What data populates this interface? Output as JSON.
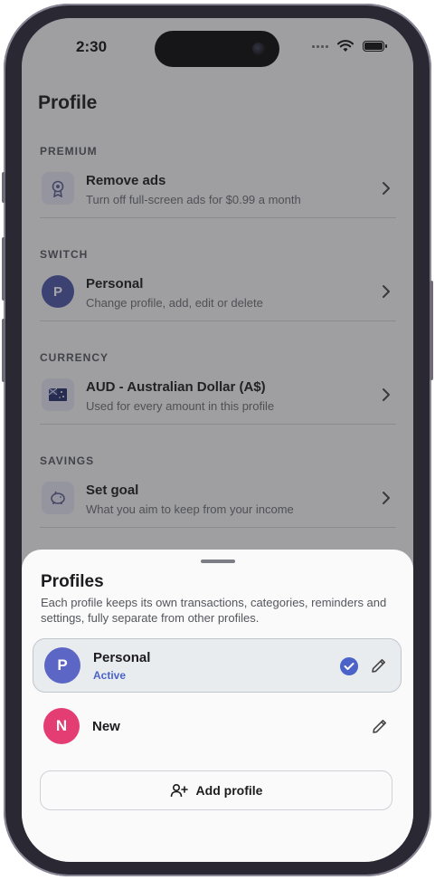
{
  "status_bar": {
    "time": "2:30"
  },
  "page": {
    "title": "Profile"
  },
  "sections": [
    {
      "label": "PREMIUM",
      "title": "Remove ads",
      "subtitle": "Turn off full-screen ads for $0.99 a month",
      "icon": "ribbon-icon"
    },
    {
      "label": "SWITCH",
      "title": "Personal",
      "subtitle": "Change profile, add, edit or delete",
      "avatar_letter": "P",
      "avatar_color": "#4b56a6"
    },
    {
      "label": "CURRENCY",
      "title": "AUD - Australian Dollar (A$)",
      "subtitle": "Used for every amount in this profile",
      "icon": "flag-icon"
    },
    {
      "label": "SAVINGS",
      "title": "Set goal",
      "subtitle": "What you aim to keep from your income",
      "icon": "piggy-bank-icon"
    }
  ],
  "sheet": {
    "title": "Profiles",
    "description": "Each profile keeps its own transactions, categories, reminders and settings, fully separate from other profiles.",
    "profiles": [
      {
        "letter": "P",
        "name": "Personal",
        "status": "Active",
        "color": "#5c66c4"
      },
      {
        "letter": "N",
        "name": "New",
        "status": "",
        "color": "#e43d73"
      }
    ],
    "add_button_label": "Add profile"
  },
  "colors": {
    "accent": "#4b63c8",
    "active_row_bg": "#e9ecef"
  }
}
